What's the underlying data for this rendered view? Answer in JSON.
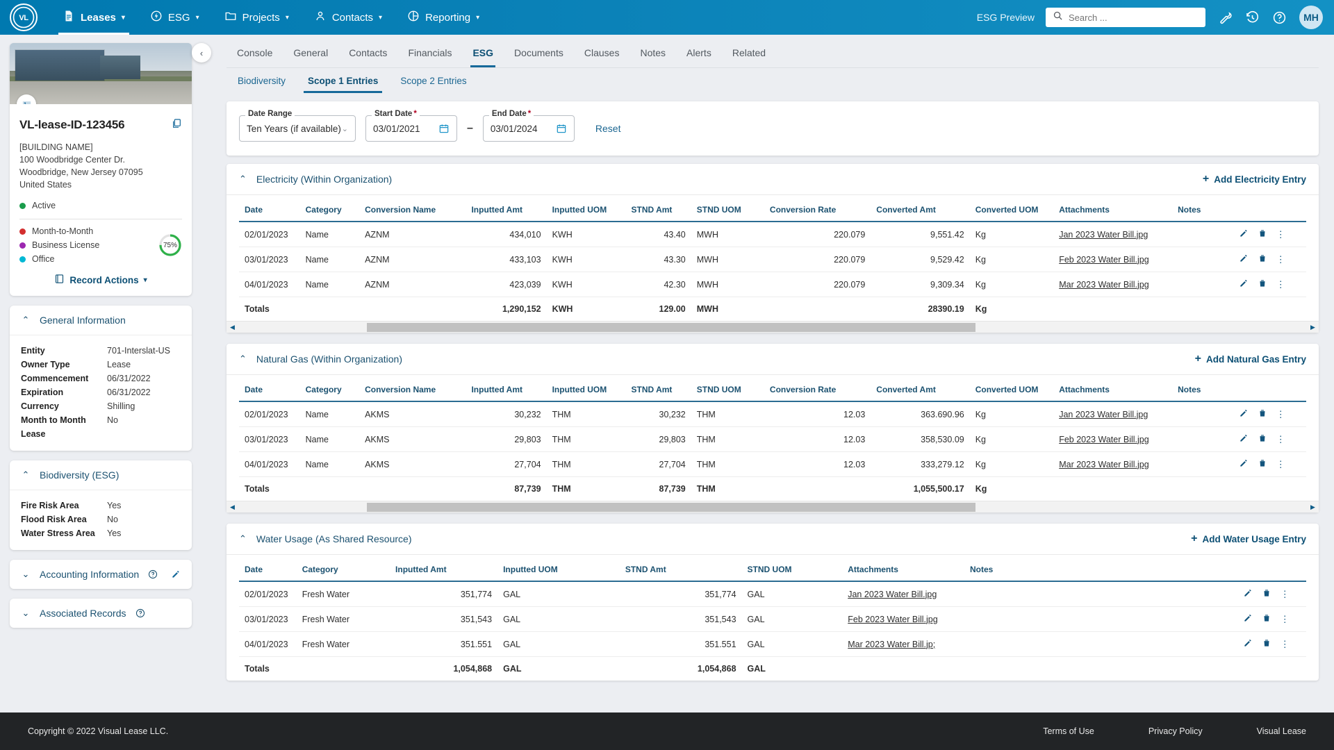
{
  "topnav": {
    "logo": "VL",
    "items": [
      {
        "label": "Leases",
        "icon": "document-icon",
        "active": true,
        "caret": true
      },
      {
        "label": "ESG",
        "icon": "energy-icon",
        "active": false,
        "caret": true
      },
      {
        "label": "Projects",
        "icon": "folder-icon",
        "active": false,
        "caret": true
      },
      {
        "label": "Contacts",
        "icon": "person-icon",
        "active": false,
        "caret": true
      },
      {
        "label": "Reporting",
        "icon": "chart-pie-icon",
        "active": false,
        "caret": true
      }
    ],
    "esg_preview": "ESG Preview",
    "search_placeholder": "Search ...",
    "search_value": "",
    "icons": [
      "wrench-icon",
      "history-icon",
      "help-icon"
    ],
    "avatar_initials": "MH",
    "accent": "#0b82b8"
  },
  "sidebar": {
    "lease_title": "VL-lease-ID-123456",
    "address": [
      "[BUILDING NAME]",
      "100 Woodbridge Center Dr.",
      "Woodbridge, New Jersey 07095",
      "United States"
    ],
    "status": {
      "label": "Active",
      "color": "#1a9c4b"
    },
    "tags": [
      {
        "label": "Month-to-Month",
        "color": "#d32f2f"
      },
      {
        "label": "Business License",
        "color": "#9c27b0"
      },
      {
        "label": "Office",
        "color": "#00b8d4"
      }
    ],
    "progress": {
      "value": "75%",
      "percent": 75,
      "color": "#2fb14a"
    },
    "record_actions_label": "Record Actions",
    "general_information": {
      "title": "General Information",
      "rows": [
        {
          "key": "Entity",
          "value": "701-Interslat-US"
        },
        {
          "key": "Owner Type",
          "value": "Lease"
        },
        {
          "key": "Commencement",
          "value": "06/31/2022"
        },
        {
          "key": "Expiration",
          "value": "06/31/2022"
        },
        {
          "key": "Currency",
          "value": "Shilling"
        },
        {
          "key": "Month to Month Lease",
          "value": "No"
        }
      ]
    },
    "biodiversity": {
      "title": "Biodiversity (ESG)",
      "rows": [
        {
          "key": "Fire Risk Area",
          "value": "Yes"
        },
        {
          "key": "Flood Risk Area",
          "value": "No"
        },
        {
          "key": "Water Stress Area",
          "value": "Yes"
        }
      ]
    },
    "accounting_information": {
      "title": "Accounting Information"
    },
    "associated_records": {
      "title": "Associated Records"
    }
  },
  "tabs": [
    {
      "label": "Console",
      "active": false
    },
    {
      "label": "General",
      "active": false
    },
    {
      "label": "Contacts",
      "active": false
    },
    {
      "label": "Financials",
      "active": false
    },
    {
      "label": "ESG",
      "active": true
    },
    {
      "label": "Documents",
      "active": false
    },
    {
      "label": "Clauses",
      "active": false
    },
    {
      "label": "Notes",
      "active": false
    },
    {
      "label": "Alerts",
      "active": false
    },
    {
      "label": "Related",
      "active": false
    }
  ],
  "subtabs": [
    {
      "label": "Biodiversity",
      "active": false
    },
    {
      "label": "Scope 1 Entries",
      "active": true
    },
    {
      "label": "Scope 2 Entries",
      "active": false
    }
  ],
  "filters": {
    "date_range": {
      "label": "Date Range",
      "value": "Ten Years (if available)"
    },
    "start_date": {
      "label": "Start Date",
      "value": "03/01/2021",
      "required": true
    },
    "end_date": {
      "label": "End Date",
      "value": "03/01/2024",
      "required": true
    },
    "separator": "–",
    "reset_label": "Reset"
  },
  "sections": [
    {
      "title": "Electricity (Within Organization)",
      "add_label": "Add Electricity Entry",
      "columns": [
        "Date",
        "Category",
        "Conversion Name",
        "Inputted Amt",
        "Inputted UOM",
        "STND Amt",
        "STND UOM",
        "Conversion Rate",
        "Converted Amt",
        "Converted UOM",
        "Attachments",
        "Notes"
      ],
      "rows": [
        {
          "date": "02/01/2023",
          "category": "Name",
          "conversion_name": "AZNM",
          "inputted_amt": "434,010",
          "inputted_uom": "KWH",
          "stnd_amt": "43.40",
          "stnd_uom": "MWH",
          "conversion_rate": "220.079",
          "converted_amt": "9,551.42",
          "converted_uom": "Kg",
          "attachment": "Jan 2023 Water Bill.jpg",
          "notes": ""
        },
        {
          "date": "03/01/2023",
          "category": "Name",
          "conversion_name": "AZNM",
          "inputted_amt": "433,103",
          "inputted_uom": "KWH",
          "stnd_amt": "43.30",
          "stnd_uom": "MWH",
          "conversion_rate": "220.079",
          "converted_amt": "9,529.42",
          "converted_uom": "Kg",
          "attachment": "Feb 2023 Water Bill.jpg",
          "notes": ""
        },
        {
          "date": "04/01/2023",
          "category": "Name",
          "conversion_name": "AZNM",
          "inputted_amt": "423,039",
          "inputted_uom": "KWH",
          "stnd_amt": "42.30",
          "stnd_uom": "MWH",
          "conversion_rate": "220.079",
          "converted_amt": "9,309.34",
          "converted_uom": "Kg",
          "attachment": "Mar 2023 Water Bill.jpg",
          "notes": ""
        }
      ],
      "totals": {
        "label": "Totals",
        "inputted_amt": "1,290,152",
        "inputted_uom": "KWH",
        "stnd_amt": "129.00",
        "stnd_uom": "MWH",
        "conversion_rate": "",
        "converted_amt": "28390.19",
        "converted_uom": "Kg"
      },
      "scroll": {
        "thumb_left_pct": 12,
        "thumb_width_pct": 57
      }
    },
    {
      "title": "Natural Gas (Within Organization)",
      "add_label": "Add Natural Gas Entry",
      "columns": [
        "Date",
        "Category",
        "Conversion Name",
        "Inputted Amt",
        "Inputted UOM",
        "STND Amt",
        "STND UOM",
        "Conversion Rate",
        "Converted Amt",
        "Converted UOM",
        "Attachments",
        "Notes"
      ],
      "rows": [
        {
          "date": "02/01/2023",
          "category": "Name",
          "conversion_name": "AKMS",
          "inputted_amt": "30,232",
          "inputted_uom": "THM",
          "stnd_amt": "30,232",
          "stnd_uom": "THM",
          "conversion_rate": "12.03",
          "converted_amt": "363.690.96",
          "converted_uom": "Kg",
          "attachment": "Jan 2023 Water Bill.jpg",
          "notes": ""
        },
        {
          "date": "03/01/2023",
          "category": "Name",
          "conversion_name": "AKMS",
          "inputted_amt": "29,803",
          "inputted_uom": "THM",
          "stnd_amt": "29,803",
          "stnd_uom": "THM",
          "conversion_rate": "12.03",
          "converted_amt": "358,530.09",
          "converted_uom": "Kg",
          "attachment": "Feb 2023 Water Bill.jpg",
          "notes": ""
        },
        {
          "date": "04/01/2023",
          "category": "Name",
          "conversion_name": "AKMS",
          "inputted_amt": "27,704",
          "inputted_uom": "THM",
          "stnd_amt": "27,704",
          "stnd_uom": "THM",
          "conversion_rate": "12.03",
          "converted_amt": "333,279.12",
          "converted_uom": "Kg",
          "attachment": "Mar 2023 Water Bill.jpg",
          "notes": ""
        }
      ],
      "totals": {
        "label": "Totals",
        "inputted_amt": "87,739",
        "inputted_uom": "THM",
        "stnd_amt": "87,739",
        "stnd_uom": "THM",
        "conversion_rate": "",
        "converted_amt": "1,055,500.17",
        "converted_uom": "Kg"
      },
      "scroll": {
        "thumb_left_pct": 12,
        "thumb_width_pct": 57
      }
    }
  ],
  "water_section": {
    "title": "Water Usage (As Shared Resource)",
    "add_label": "Add  Water Usage Entry",
    "columns": [
      "Date",
      "Category",
      "Inputted Amt",
      "Inputted UOM",
      "STND Amt",
      "STND UOM",
      "Attachments",
      "Notes"
    ],
    "rows": [
      {
        "date": "02/01/2023",
        "category": "Fresh Water",
        "inputted_amt": "351,774",
        "inputted_uom": "GAL",
        "stnd_amt": "351,774",
        "stnd_uom": "GAL",
        "attachment": "Jan 2023 Water Bill.jpg",
        "notes": ""
      },
      {
        "date": "03/01/2023",
        "category": "Fresh Water",
        "inputted_amt": "351,543",
        "inputted_uom": "GAL",
        "stnd_amt": "351,543",
        "stnd_uom": "GAL",
        "attachment": "Feb 2023 Water Bill.jpg",
        "notes": ""
      },
      {
        "date": "04/01/2023",
        "category": "Fresh Water",
        "inputted_amt": "351.551",
        "inputted_uom": "GAL",
        "stnd_amt": "351.551",
        "stnd_uom": "GAL",
        "attachment": "Mar 2023 Water Bill.jp;",
        "notes": ""
      }
    ],
    "totals": {
      "label": "Totals",
      "inputted_amt": "1,054,868",
      "inputted_uom": "GAL",
      "stnd_amt": "1,054,868",
      "stnd_uom": "GAL"
    }
  },
  "footer": {
    "copyright": "Copyright © 2022 Visual Lease LLC.",
    "links": [
      "Terms of Use",
      "Privacy Policy",
      "Visual Lease"
    ]
  }
}
